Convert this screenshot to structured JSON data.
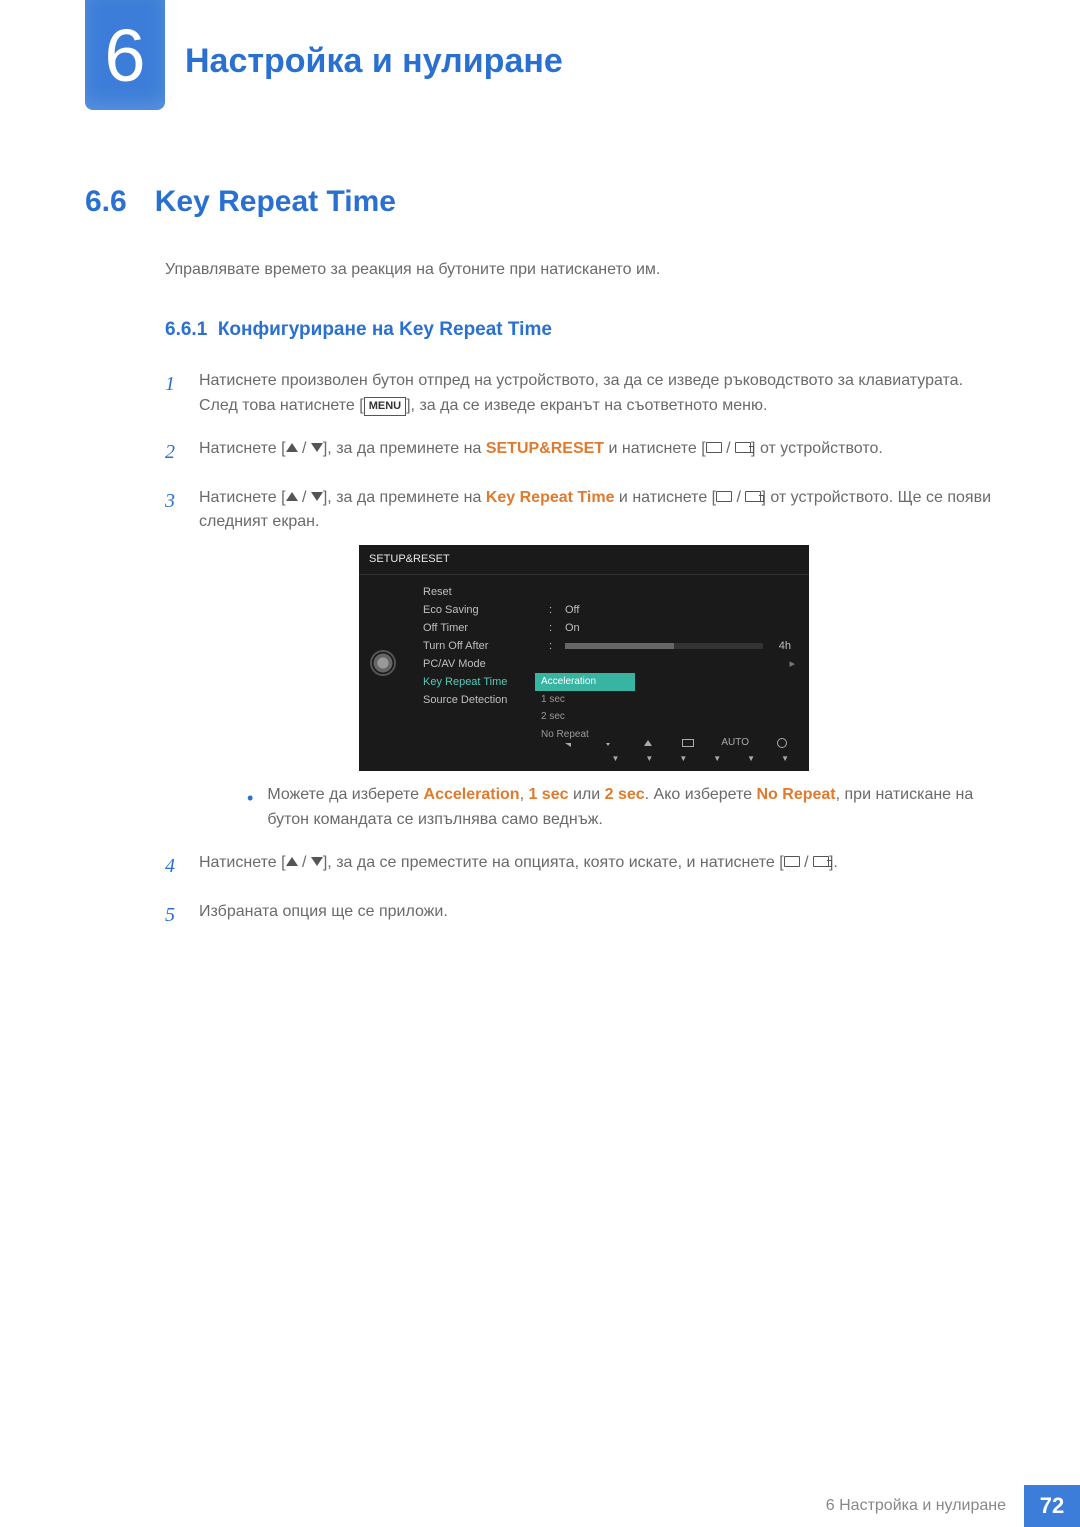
{
  "chapter": {
    "number": "6",
    "title": "Настройка и нулиране"
  },
  "section": {
    "number": "6.6",
    "title": "Key Repeat Time"
  },
  "intro": "Управлявате времето за реакция на бутоните при натискането им.",
  "subsection": {
    "number": "6.6.1",
    "title": "Конфигуриране на Key Repeat Time"
  },
  "steps": {
    "s1": "Натиснете произволен бутон отпред на устройството, за да се изведе ръководството за клавиатурата. След това натиснете [",
    "s1b": "], за да се изведе екранът на съответното меню.",
    "s2a": "Натиснете [",
    "s2b": "], за да преминете на ",
    "s2c": " и натиснете [",
    "s2d": "] от устройството.",
    "s3a": "Натиснете [",
    "s3b": "], за да преминете на ",
    "s3c": " и натиснете [",
    "s3d": "] от устройството. Ще се появи следният екран.",
    "s4a": "Натиснете [",
    "s4b": "], за да се преместите на опцията, която искате, и натиснете [",
    "s4c": "].",
    "s5": "Избраната опция ще се приложи."
  },
  "hl": {
    "menu": "MENU",
    "setup_reset": "SETUP&RESET",
    "key_repeat_time": "Key Repeat Time",
    "acceleration": "Acceleration",
    "one_sec": "1 sec",
    "two_sec": "2 sec",
    "no_repeat": "No Repeat"
  },
  "bullet": {
    "a": "Можете да изберете ",
    "b": ", ",
    "c": " или ",
    "d": ". Ако изберете ",
    "e": ", при натискане на бутон командата се изпълнява само веднъж."
  },
  "osd": {
    "title": "SETUP&RESET",
    "items": {
      "reset": "Reset",
      "eco": "Eco Saving",
      "off_timer": "Off Timer",
      "turn_off": "Turn Off After",
      "pcav": "PC/AV Mode",
      "krt": "Key Repeat Time",
      "source": "Source Detection"
    },
    "vals": {
      "off": "Off",
      "on": "On",
      "hours": "4h"
    },
    "submenu": [
      "Acceleration",
      "1 sec",
      "2 sec",
      "No Repeat"
    ],
    "auto": "AUTO"
  },
  "footer": {
    "text": "6 Настройка и нулиране",
    "page": "72"
  }
}
